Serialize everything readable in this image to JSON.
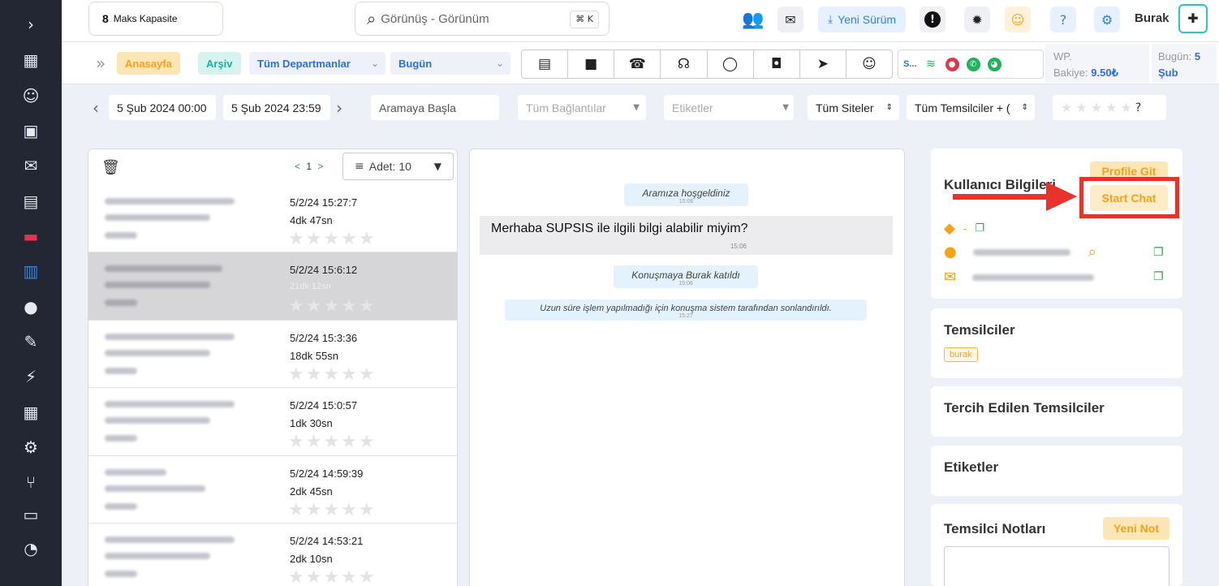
{
  "sidebar": {
    "icons": [
      {
        "name": "expand-chevron-icon",
        "glyph": "›"
      },
      {
        "name": "chat-bubbles-icon",
        "glyph": "▦"
      },
      {
        "name": "bot-icon",
        "glyph": "☺"
      },
      {
        "name": "contacts-icon",
        "glyph": "▣"
      },
      {
        "name": "mail-icon",
        "glyph": "✉"
      },
      {
        "name": "clipboard-icon",
        "glyph": "▤"
      },
      {
        "name": "ticket-icon",
        "glyph": "▬"
      },
      {
        "name": "inbox-icon",
        "glyph": "▥"
      },
      {
        "name": "users-icon",
        "glyph": "●"
      },
      {
        "name": "edit-icon",
        "glyph": "✎"
      },
      {
        "name": "lightning-icon",
        "glyph": "⚡"
      },
      {
        "name": "grid-icon",
        "glyph": "▦"
      },
      {
        "name": "settings-gear-icon",
        "glyph": "⚙"
      },
      {
        "name": "share-icon",
        "glyph": "⑂"
      },
      {
        "name": "card-icon",
        "glyph": "▭"
      },
      {
        "name": "pie-chart-icon",
        "glyph": "◔"
      }
    ]
  },
  "topbar": {
    "capacity_number": "8",
    "capacity_label": "Maks Kapasite",
    "search_placeholder": "Görünüş - Görünüm",
    "search_shortcut": "⌘ K",
    "new_version": "Yeni Sürüm",
    "user_name": "Burak"
  },
  "subbar": {
    "home": "Anasayfa",
    "archive": "Arşiv",
    "department": "Tüm Departmanlar",
    "date_range": "Bugün",
    "status_label": "S...",
    "wp_label": "WP.",
    "balance_label": "Bakiye:",
    "balance_value": "9.50₺",
    "today_label": "Bugün:",
    "today_value": "5",
    "today_month": "Şub"
  },
  "filters": {
    "start_date": "5 Şub 2024 00:00",
    "end_date": "5 Şub 2024 23:59",
    "search_placeholder": "Aramaya Başla",
    "connections": "Tüm Bağlantılar",
    "tags": "Etiketler",
    "sites": "Tüm Siteler",
    "agents": "Tüm Temsilciler + (",
    "rating_help": "?"
  },
  "list": {
    "pager_prev": "<",
    "pager_page": "1",
    "pager_next": ">",
    "per_page": "Adet: 10",
    "rows": [
      {
        "date": "5/2/24 15:27:7",
        "duration": "4dk 47sn"
      },
      {
        "date": "5/2/24 15:6:12",
        "duration": "21dk 12sn"
      },
      {
        "date": "5/2/24 15:3:36",
        "duration": "18dk 55sn"
      },
      {
        "date": "5/2/24 15:0:57",
        "duration": "1dk 30sn"
      },
      {
        "date": "5/2/24 14:59:39",
        "duration": "2dk 45sn"
      },
      {
        "date": "5/2/24 14:53:21",
        "duration": "2dk 10sn"
      }
    ]
  },
  "chat": {
    "welcome": "Aramıza hoşgeldiniz",
    "welcome_time": "15:06",
    "user_message": "Merhaba SUPSIS ile ilgili bilgi alabilir miyim?",
    "user_message_time": "15:06",
    "joined": "Konuşmaya Burak katıldı",
    "joined_time": "15:06",
    "ended": "Uzun süre işlem yapılmadığı için konuşma sistem tarafından sonlandırıldı.",
    "ended_time": "15:27"
  },
  "right": {
    "user_info_title": "Kullanıcı Bilgileri",
    "profile_button": "Profile Git",
    "start_chat": "Start Chat",
    "tag_value": "-",
    "agents_title": "Temsilciler",
    "agent_tag": "burak",
    "preferred_title": "Tercih Edilen Temsilciler",
    "tags_title": "Etiketler",
    "notes_title": "Temsilci Notları",
    "new_note": "Yeni Not"
  },
  "colors": {
    "sidebar_bg": "#232733",
    "accent_blue": "#2f7fe0",
    "accent_orange": "#f5a11a",
    "annotation_red": "#e8322a"
  }
}
